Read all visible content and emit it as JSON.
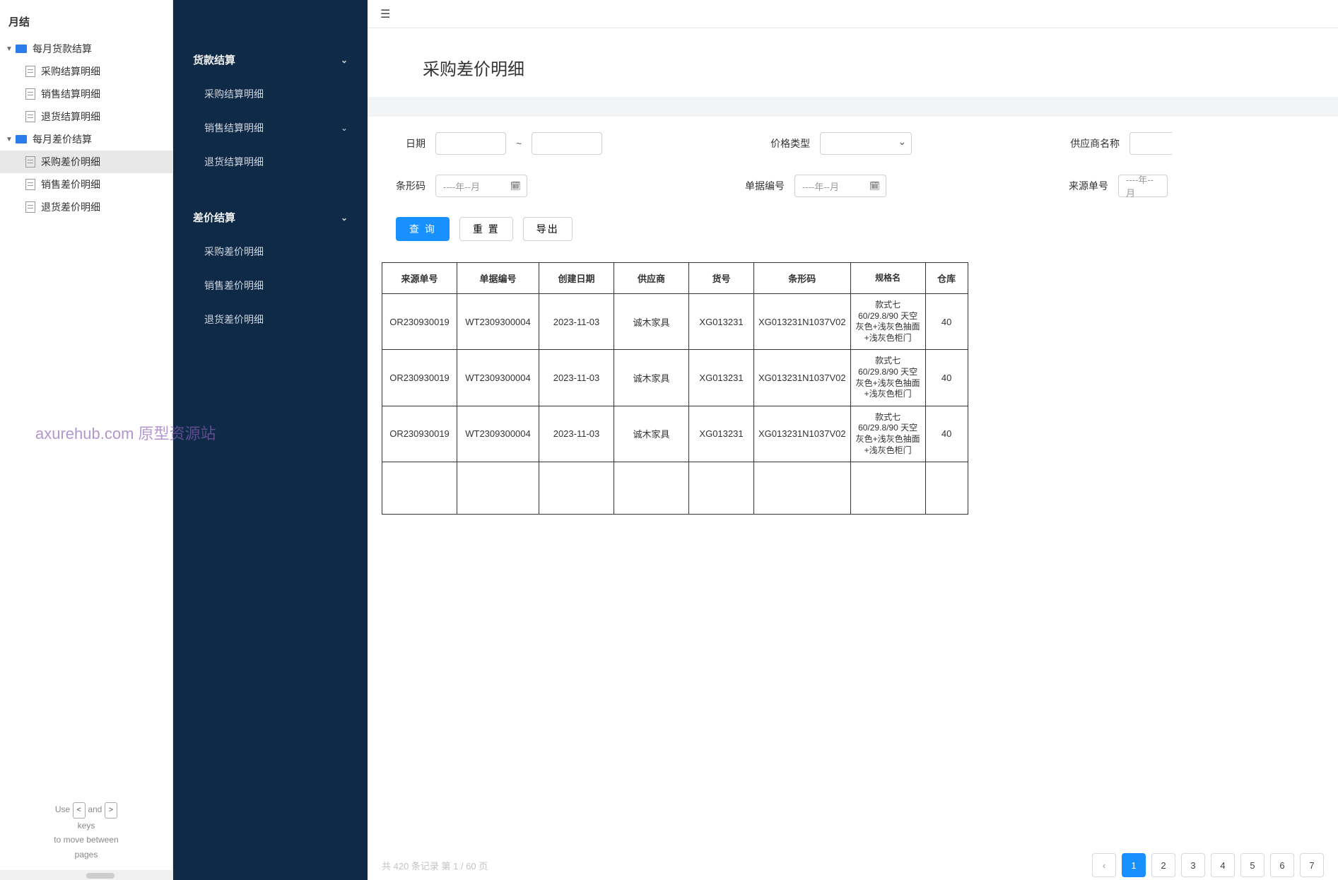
{
  "tree": {
    "title": "月结",
    "groups": [
      {
        "label": "每月货款结算",
        "items": [
          "采购结算明细",
          "销售结算明细",
          "退货结算明细"
        ]
      },
      {
        "label": "每月差价结算",
        "items": [
          "采购差价明细",
          "销售差价明细",
          "退货差价明细"
        ]
      }
    ],
    "selected": "采购差价明细",
    "footer": {
      "l1a": "Use",
      "l1b": "and",
      "k1": "<",
      "k2": ">",
      "l2": "keys",
      "l3": "to move between",
      "l4": "pages"
    }
  },
  "sidenav": {
    "g1": {
      "title": "货款结算",
      "items": [
        "采购结算明细",
        "销售结算明细",
        "退货结算明细"
      ],
      "subChev": [
        false,
        true,
        false
      ]
    },
    "g2": {
      "title": "差价结算",
      "items": [
        "采购差价明细",
        "销售差价明细",
        "退货差价明细"
      ]
    }
  },
  "page": {
    "title": "采购差价明细"
  },
  "filters": {
    "date_label": "日期",
    "range_sep": "~",
    "price_type_label": "价格类型",
    "supplier_label": "供应商名称",
    "barcode_label": "条形码",
    "docno_label": "单据编号",
    "srcno_label": "来源单号",
    "date_placeholder": "----年--月",
    "date_placeholder_cut": "----年--月"
  },
  "buttons": {
    "query": "查 询",
    "reset": "重 置",
    "export": "导出"
  },
  "table": {
    "headers": [
      "来源单号",
      "单据编号",
      "创建日期",
      "供应商",
      "货号",
      "条形码",
      "规格名",
      "仓库"
    ],
    "rows": [
      {
        "src": "OR230930019",
        "doc": "WT2309300004",
        "date": "2023-11-03",
        "sup": "诚木家具",
        "hh": "XG013231",
        "bar": "XG013231N1037V02",
        "spec": "款式七 60/29.8/90 天空灰色+浅灰色抽面+浅灰色柜门",
        "wh": "40"
      },
      {
        "src": "OR230930019",
        "doc": "WT2309300004",
        "date": "2023-11-03",
        "sup": "诚木家具",
        "hh": "XG013231",
        "bar": "XG013231N1037V02",
        "spec": "款式七 60/29.8/90 天空灰色+浅灰色抽面+浅灰色柜门",
        "wh": "40"
      },
      {
        "src": "OR230930019",
        "doc": "WT2309300004",
        "date": "2023-11-03",
        "sup": "诚木家具",
        "hh": "XG013231",
        "bar": "XG013231N1037V02",
        "spec": "款式七 60/29.8/90 天空灰色+浅灰色抽面+浅灰色柜门",
        "wh": "40"
      }
    ]
  },
  "pager": {
    "info": "共 420 条记录 第 1 / 60 页",
    "pages": [
      "1",
      "2",
      "3",
      "4",
      "5",
      "6",
      "7"
    ]
  },
  "watermark": "axurehub.com 原型资源站"
}
